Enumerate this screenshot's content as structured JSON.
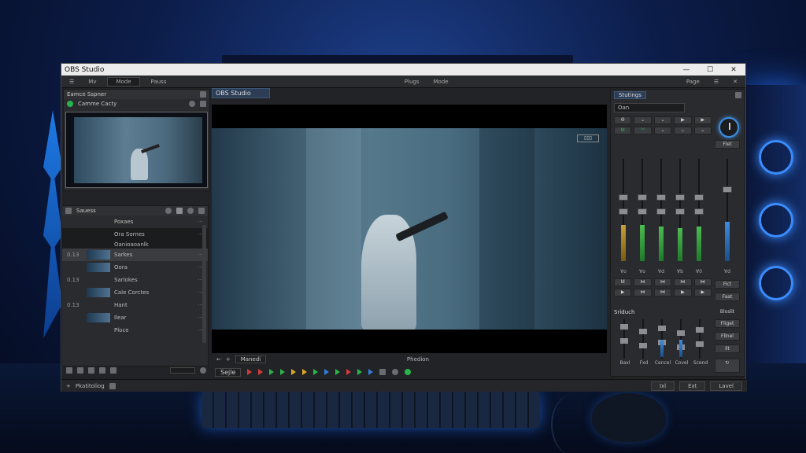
{
  "window": {
    "title": "OBS Studio",
    "controls": [
      "—",
      "☐",
      "✕"
    ]
  },
  "menubar": {
    "items": [
      "☰",
      "Mv",
      "Mode",
      "Pauss"
    ],
    "center": [
      "Plugs",
      "Mode"
    ],
    "right": [
      "Page",
      "☰",
      "✕"
    ]
  },
  "sources_panel": {
    "title": "Eamce Sspner",
    "subtitle": "Camme Cacty"
  },
  "scenes_panel": {
    "title": "Sauess",
    "rows": [
      {
        "num": "",
        "name": "Poxaes",
        "selected": false,
        "thumb": false
      },
      {
        "num": "",
        "name": "Ora Sornes",
        "sub": "Oanioaoanlk",
        "selected": false,
        "thumb": false,
        "dark": true
      },
      {
        "num": "0.13",
        "name": "Sarkes",
        "selected": true,
        "thumb": true
      },
      {
        "num": "",
        "name": "Oora",
        "selected": false,
        "thumb": true
      },
      {
        "num": "0.13",
        "name": "Sarlokes",
        "selected": false,
        "thumb": false
      },
      {
        "num": "",
        "name": "Cale Corctes",
        "selected": false,
        "thumb": true
      },
      {
        "num": "0.13",
        "name": "Hant",
        "selected": false,
        "thumb": false
      },
      {
        "num": "",
        "name": "Ilear",
        "selected": false,
        "thumb": true
      },
      {
        "num": "",
        "name": "Ploce",
        "selected": false,
        "thumb": false
      }
    ]
  },
  "preview": {
    "tab": "OBS Studio",
    "view_chip": "▯▯▯",
    "bar_left": "Manedi",
    "bar_mid": "Phedion"
  },
  "transport": {
    "dropdown": "Sejle"
  },
  "mixer": {
    "title": "Stutings",
    "input": "Oan",
    "btn_row1": [
      "Ɵ",
      "⌄",
      "⌄",
      "▶",
      "▶"
    ],
    "btn_row2": [
      "Ꮇ",
      "⁴⁴",
      "⌄",
      "⌄",
      "⌄"
    ],
    "channels": [
      "Ɐo",
      "Ɐo",
      "Ɐd",
      "Ɐb",
      "Ɐ0"
    ],
    "side_label": "Flet",
    "side_channel": "Ɐd",
    "ctrl_row1": [
      "Ꮇ",
      "⋈",
      "⋈",
      "⋈",
      "⋈"
    ],
    "ctrl_row2": [
      "▶",
      "⋈",
      "⋈",
      "▶",
      "▶"
    ],
    "side_btns": [
      "Fict",
      "Faat"
    ],
    "sub_title": "Sriduch",
    "sub_labels": [
      "Baxl",
      "Fxd",
      "Cencel",
      "Covel",
      "Scend"
    ],
    "sub_side_title": "Bloslit",
    "sub_side_btns": [
      "Fliget",
      "Fllnel",
      "Ilt"
    ]
  },
  "status": {
    "left": "Pkatitoliog",
    "buttons": [
      "Ixl",
      "Ext",
      "Lavel"
    ]
  },
  "colors": {
    "accent": "#3d8de0",
    "green": "#2ab34a",
    "red": "#d23a3a"
  }
}
